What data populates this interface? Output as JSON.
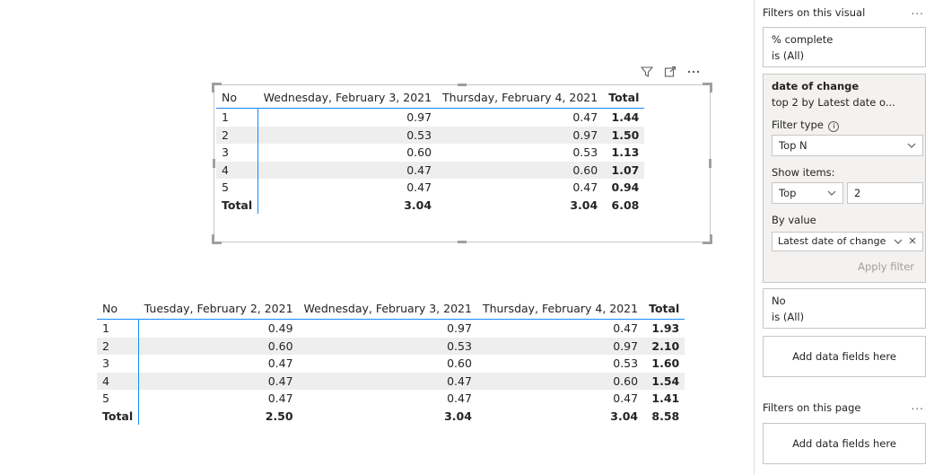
{
  "visual1": {
    "icons": [
      "filter-icon",
      "focus-mode-icon",
      "more-options-icon"
    ],
    "headers": {
      "row": "No",
      "cols": [
        "Wednesday, February 3, 2021",
        "Thursday, February 4, 2021"
      ],
      "total": "Total"
    },
    "rows": [
      {
        "no": "1",
        "v": [
          "0.97",
          "0.47"
        ],
        "total": "1.44"
      },
      {
        "no": "2",
        "v": [
          "0.53",
          "0.97"
        ],
        "total": "1.50"
      },
      {
        "no": "3",
        "v": [
          "0.60",
          "0.53"
        ],
        "total": "1.13"
      },
      {
        "no": "4",
        "v": [
          "0.47",
          "0.60"
        ],
        "total": "1.07"
      },
      {
        "no": "5",
        "v": [
          "0.47",
          "0.47"
        ],
        "total": "0.94"
      }
    ],
    "totals": {
      "label": "Total",
      "v": [
        "3.04",
        "3.04"
      ],
      "total": "6.08"
    }
  },
  "visual2": {
    "headers": {
      "row": "No",
      "cols": [
        "Tuesday, February 2, 2021",
        "Wednesday, February 3, 2021",
        "Thursday, February 4, 2021"
      ],
      "total": "Total"
    },
    "rows": [
      {
        "no": "1",
        "v": [
          "0.49",
          "0.97",
          "0.47"
        ],
        "total": "1.93"
      },
      {
        "no": "2",
        "v": [
          "0.60",
          "0.53",
          "0.97"
        ],
        "total": "2.10"
      },
      {
        "no": "3",
        "v": [
          "0.47",
          "0.60",
          "0.53"
        ],
        "total": "1.60"
      },
      {
        "no": "4",
        "v": [
          "0.47",
          "0.47",
          "0.60"
        ],
        "total": "1.54"
      },
      {
        "no": "5",
        "v": [
          "0.47",
          "0.47",
          "0.47"
        ],
        "total": "1.41"
      }
    ],
    "totals": {
      "label": "Total",
      "v": [
        "2.50",
        "3.04",
        "3.04"
      ],
      "total": "8.58"
    }
  },
  "filters": {
    "visual_title": "Filters on this visual",
    "more": "...",
    "pct_complete": {
      "name": "% complete",
      "state": "is (All)"
    },
    "date_of_change": {
      "name": "date of change",
      "summary": "top 2 by Latest date o...",
      "filter_type_label": "Filter type",
      "filter_type_value": "Top N",
      "show_items_label": "Show items:",
      "show_items_direction": "Top",
      "show_items_count": "2",
      "by_value_label": "By value",
      "by_value_field": "Latest date of change",
      "apply": "Apply filter"
    },
    "no": {
      "name": "No",
      "state": "is (All)"
    },
    "add_fields": "Add data fields here",
    "page_title": "Filters on this page",
    "page_add_fields": "Add data fields here"
  },
  "colors": {
    "accent": "#118dff",
    "alt_row": "#eeeeee",
    "pane_border": "#c8c6c4"
  }
}
